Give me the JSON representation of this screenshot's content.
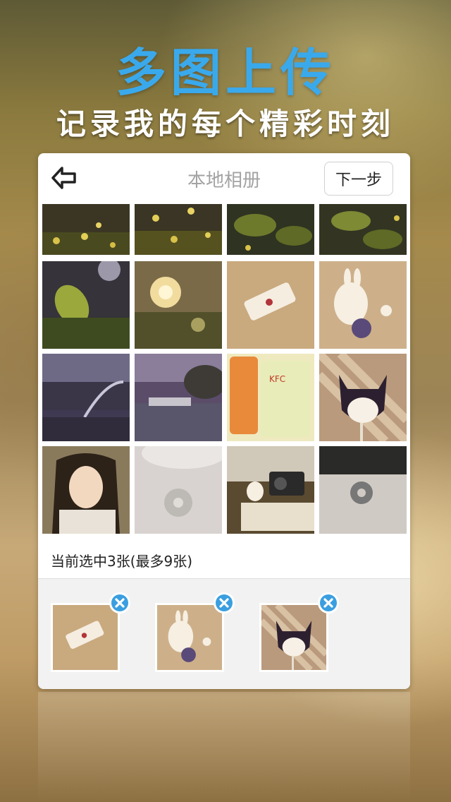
{
  "hero": {
    "title": "多图上传",
    "subtitle": "记录我的每个精彩时刻"
  },
  "header": {
    "back_icon": "back-arrow-icon",
    "title": "本地相册",
    "next_label": "下一步"
  },
  "photos": [
    {
      "name": "photo-flowers-night-1"
    },
    {
      "name": "photo-flowers-night-2"
    },
    {
      "name": "photo-leaves-night-1"
    },
    {
      "name": "photo-leaves-night-2"
    },
    {
      "name": "photo-leaf-streetlight"
    },
    {
      "name": "photo-bushes-streetlight"
    },
    {
      "name": "photo-plate-candy"
    },
    {
      "name": "photo-rabbit-figure"
    },
    {
      "name": "photo-fountain-park"
    },
    {
      "name": "photo-street-scene"
    },
    {
      "name": "photo-kfc-drinks"
    },
    {
      "name": "photo-cat-illustration"
    },
    {
      "name": "photo-girl-portrait"
    },
    {
      "name": "photo-ring-candy"
    },
    {
      "name": "photo-camera-figure"
    },
    {
      "name": "photo-ring-desk"
    }
  ],
  "selection": {
    "status_text": "当前选中3张(最多9张)",
    "selected": [
      {
        "name": "selected-plate-candy"
      },
      {
        "name": "selected-rabbit-figure"
      },
      {
        "name": "selected-cat-illustration"
      }
    ],
    "remove_icon": "remove-icon"
  },
  "colors": {
    "accent": "#3aa9ec",
    "remove_badge": "#3a9fe0"
  }
}
